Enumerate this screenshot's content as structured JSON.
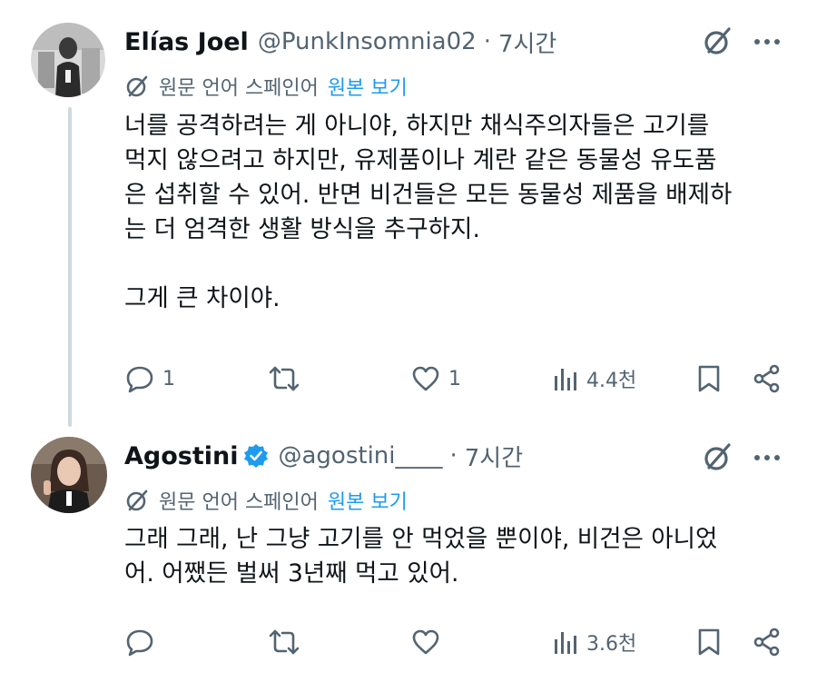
{
  "tweets": [
    {
      "name": "Elías Joel",
      "handle": "@PunkInsomnia02",
      "separator": "·",
      "time": "7시간",
      "translation": {
        "label": "원문 언어 스페인어",
        "link": "원본 보기"
      },
      "body": [
        "너를 공격하려는 게 아니야, 하지만 채식주의자들은 고기를",
        "먹지 않으려고 하지만, 유제품이나 계란 같은 동물성 유도품",
        "은 섭취할 수 있어. 반면 비건들은 모든 동물성 제품을 배제하",
        "는 더 엄격한 생활 방식을 추구하지.",
        "",
        "그게 큰 차이야."
      ],
      "metrics": {
        "replies": "1",
        "retweets": "",
        "likes": "1",
        "views": "4.4천"
      }
    },
    {
      "name": "Agostini",
      "handle": "@agostini____",
      "separator": "·",
      "time": "7시간",
      "verified": true,
      "translation": {
        "label": "원문 언어 스페인어",
        "link": "원본 보기"
      },
      "body": [
        "그래 그래, 난 그냥 고기를 안 먹었을 뿐이야, 비건은 아니었",
        "어. 어쨌든 벌써 3년째 먹고 있어."
      ],
      "metrics": {
        "replies": "",
        "retweets": "",
        "likes": "",
        "views": "3.6천"
      }
    }
  ],
  "icons": {
    "reply": "reply-icon",
    "retweet": "retweet-icon",
    "like": "heart-icon",
    "views": "views-icon",
    "bookmark": "bookmark-icon",
    "share": "share-icon",
    "grok": "grok-icon",
    "more": "more-icon",
    "translate": "translate-icon",
    "verified": "verified-badge-icon"
  },
  "colors": {
    "text": "#0f1419",
    "secondary": "#536471",
    "link": "#1d9bf0",
    "thread": "#cfd9de"
  }
}
